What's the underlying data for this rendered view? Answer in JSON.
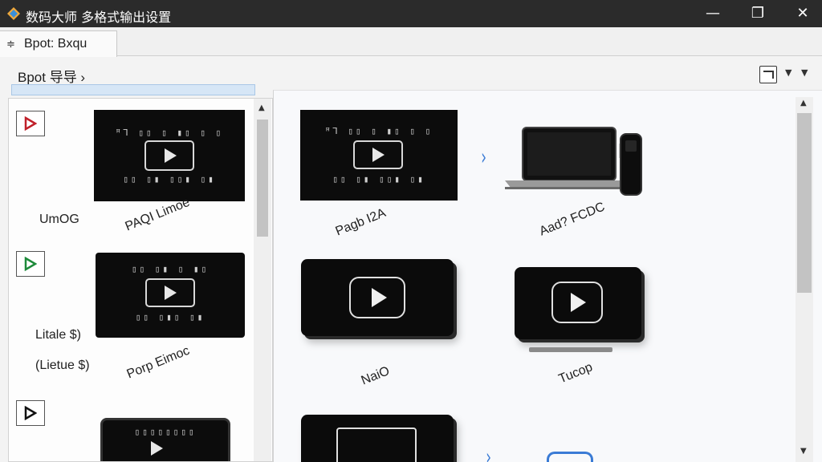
{
  "window": {
    "title": "数码大师   多格式输出设置",
    "min_glyph": "—",
    "max_glyph": "❐",
    "close_glyph": "✕"
  },
  "tab": {
    "icon": "≑",
    "label": "Bpot:  Bxqu"
  },
  "breadcrumb": {
    "text": "Bpot 导导 ›"
  },
  "toolbar": {
    "view_icon": "export-view-icon",
    "dropdown_glyph": "▼"
  },
  "left_list": {
    "items": [
      {
        "label": "UmOG",
        "thumb_caption": "PAQI  Limoe"
      },
      {
        "label": "Litale $)",
        "label2": "(Lietue $)",
        "thumb_caption": "Porp  Eimoc"
      },
      {
        "label": ""
      }
    ]
  },
  "right_grid": {
    "items": [
      {
        "caption": "Pagb  I2A"
      },
      {
        "caption": "Aad?  FCDC"
      },
      {
        "caption": "NaiO"
      },
      {
        "caption": "Tucop"
      }
    ]
  },
  "scroll": {
    "up": "▲",
    "down": "▼"
  },
  "colors": {
    "accent": "#3a7bd5",
    "titlebar": "#2b2b2b",
    "selection": "#d6e6f6"
  }
}
